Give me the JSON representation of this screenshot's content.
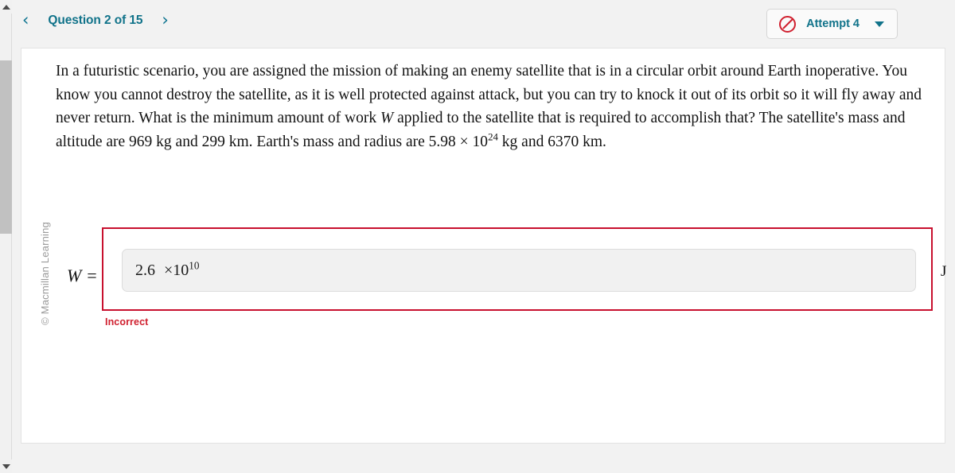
{
  "nav": {
    "prev_icon": "chevron-left-icon",
    "next_icon": "chevron-right-icon",
    "prev_glyph": "‹",
    "next_glyph": "›",
    "question_label": "Question 2 of 15"
  },
  "attempt": {
    "icon": "prohibited-icon",
    "label": "Attempt 4",
    "dropdown_icon": "caret-down-icon"
  },
  "watermark": {
    "text": "© Macmillan Learning"
  },
  "question": {
    "text_part_1": "In a futuristic scenario, you are assigned the mission of making an enemy satellite that is in a circular orbit around Earth inoperative. You know you cannot destroy the satellite, as it is well protected against attack, but you can try to knock it out of its orbit so it will fly away and never return. What is the minimum amount of work ",
    "variable_W": "W",
    "text_part_2": " applied to the satellite that is required to accomplish that? The satellite's mass and altitude are 969 kg and 299 km. Earth's mass and radius are 5.98 × 10",
    "exponent": "24",
    "text_part_3": " kg and 6370 km."
  },
  "answer": {
    "label": "W =",
    "mantissa": "2.6",
    "times_ten": "×10",
    "exponent": "10",
    "unit": "J",
    "status": "Incorrect"
  },
  "colors": {
    "teal": "#11738a",
    "error_red": "#c8102e",
    "incorrect_red": "#d0202f",
    "page_background": "#f2f2f2",
    "card_background": "#ffffff",
    "field_background": "#f1f1f1"
  }
}
